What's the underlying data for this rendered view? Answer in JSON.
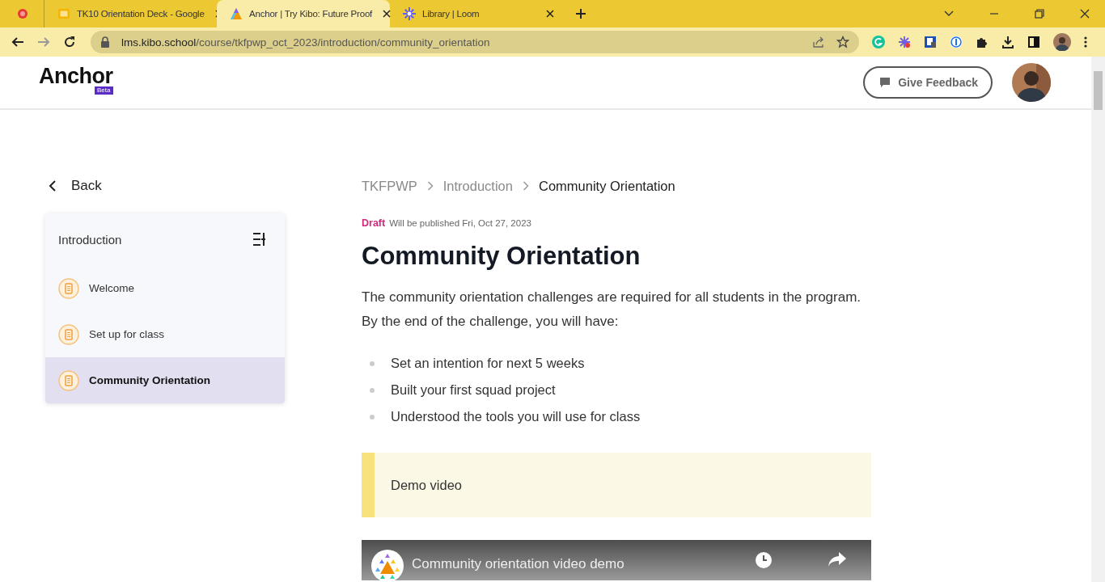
{
  "browser": {
    "tabs": [
      {
        "title": "TK10 Orientation Deck - Google",
        "selected": false,
        "kind": "slides"
      },
      {
        "title": "Anchor | Try Kibo: Future Proof",
        "selected": true,
        "kind": "anchor"
      },
      {
        "title": "Library | Loom",
        "selected": false,
        "kind": "loom"
      }
    ],
    "address": "lms.kibo.school/course/tkfpwp_oct_2023/introduction/community_orientation"
  },
  "header": {
    "logo": "Anchor",
    "badge": "Beta",
    "feedback_button": "Give Feedback"
  },
  "sidebar": {
    "back": "Back",
    "section": "Introduction",
    "items": [
      {
        "label": "Welcome",
        "selected": false
      },
      {
        "label": "Set up for class",
        "selected": false
      },
      {
        "label": "Community Orientation",
        "selected": true
      }
    ]
  },
  "breadcrumb": [
    "TKFPWP",
    "Introduction",
    "Community Orientation"
  ],
  "status": {
    "label": "Draft",
    "note": "Will be published Fri, Oct 27, 2023"
  },
  "title": "Community Orientation",
  "intro": "The community orientation challenges are required for all students in the program. By the end of the challenge, you will have:",
  "bullets": [
    "Set an intention for next 5 weeks",
    "Built your first squad project",
    "Understood the tools you will use for class"
  ],
  "callout": "Demo video",
  "video": {
    "title": "Community orientation video demo"
  }
}
